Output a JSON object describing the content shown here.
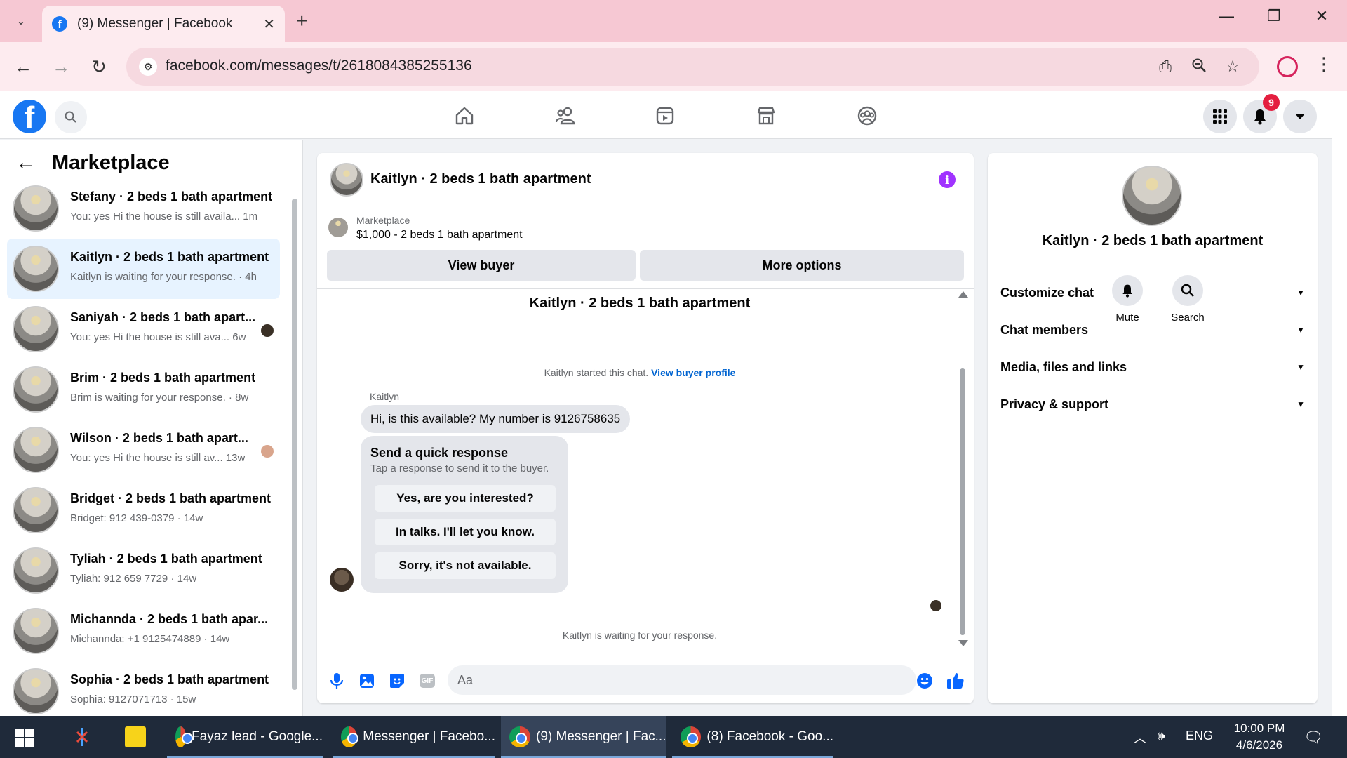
{
  "browser": {
    "tab_title": "(9) Messenger | Facebook",
    "url": "facebook.com/messages/t/2618084385255136"
  },
  "fb_nav": {
    "notification_count": "9",
    "icons": [
      "home-icon",
      "friends-icon",
      "video-icon",
      "marketplace-icon",
      "groups-icon"
    ]
  },
  "sidebar": {
    "title": "Marketplace",
    "conversations": [
      {
        "name": "Stefany · 2 beds 1 bath apartment",
        "preview": "You: yes Hi the house is still availa...  1m"
      },
      {
        "name": "Kaitlyn · 2 beds 1 bath apartment",
        "preview": "Kaitlyn is waiting for your response. · 4h"
      },
      {
        "name": "Saniyah · 2 beds 1 bath apart...",
        "preview": "You: yes Hi the house is still ava...  6w"
      },
      {
        "name": "Brim · 2 beds 1 bath apartment",
        "preview": "Brim is waiting for your response. · 8w"
      },
      {
        "name": "Wilson · 2 beds 1 bath apart...",
        "preview": "You: yes Hi the house is still av...  13w"
      },
      {
        "name": "Bridget · 2 beds 1 bath apartment",
        "preview": "Bridget: 912 439-0379 · 14w"
      },
      {
        "name": "Tyliah · 2 beds 1 bath apartment",
        "preview": "Tyliah: 912 659 7729 · 14w"
      },
      {
        "name": "Michannda · 2 beds 1 bath apar...",
        "preview": "Michannda: +1 9125474889 · 14w"
      },
      {
        "name": "Sophia · 2 beds 1 bath apartment",
        "preview": "Sophia: 9127071713 · 15w"
      }
    ]
  },
  "chat": {
    "header_name": "Kaitlyn · 2 beds 1 bath apartment",
    "listing_source": "Marketplace",
    "listing_price": "$1,000 - 2 beds 1 bath apartment",
    "view_buyer_label": "View buyer",
    "more_options_label": "More options",
    "thread_title": "Kaitlyn · 2 beds 1 bath apartment",
    "started_text": "Kaitlyn started this chat.",
    "view_buyer_profile": "View buyer profile",
    "sender": "Kaitlyn",
    "message": "Hi, is this available? My number is 9126758635",
    "quick_title": "Send a quick response",
    "quick_subtitle": "Tap a response to send it to the buyer.",
    "quick_replies": [
      "Yes, are you interested?",
      "In talks. I'll let you know.",
      "Sorry, it's not available."
    ],
    "waiting_text": "Kaitlyn is waiting for your response.",
    "input_placeholder": "Aa"
  },
  "info_panel": {
    "name": "Kaitlyn · 2 beds 1 bath apartment",
    "mute_label": "Mute",
    "search_label": "Search",
    "sections": [
      "Customize chat",
      "Chat members",
      "Media, files and links",
      "Privacy & support"
    ]
  },
  "taskbar": {
    "items": [
      "Fayaz lead - Google...",
      "Messenger | Facebo...",
      "(9) Messenger | Fac...",
      "(8) Facebook - Goo..."
    ],
    "language": "ENG",
    "time": "10:00 PM",
    "date": "4/6/2026"
  },
  "colors": {
    "fb_blue": "#1877f2",
    "tab_bar": "#f6c8d3",
    "active_conversation": "#e7f3ff",
    "info_button": "#a033ff",
    "badge_red": "#e41e3f",
    "taskbar": "#1f2a3a"
  }
}
